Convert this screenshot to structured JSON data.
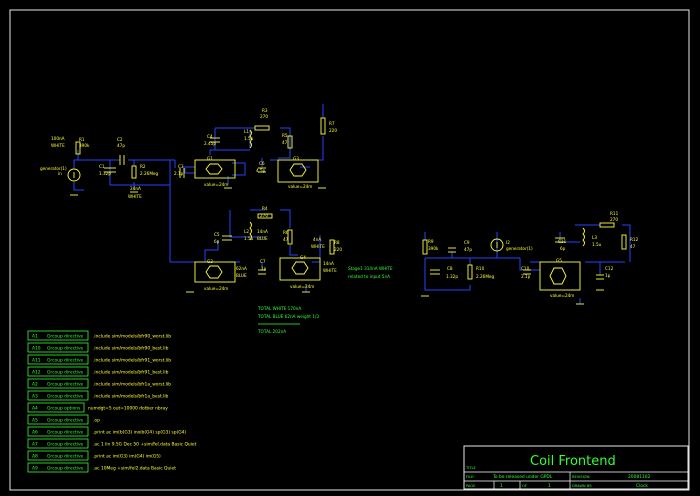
{
  "labels": {
    "src1_cur": "100nA",
    "src1_type": "WHITE",
    "r1": "R1",
    "r1_val": "390k",
    "c2": "C2",
    "c2_val": "47p",
    "c1": "C1",
    "c1_val": "1.32p",
    "r2": "R2",
    "r2_val": "2.26Meg",
    "gen1": "generator(1)",
    "gen1_pin": "in",
    "cur24": "24nA",
    "white24": "WHITE",
    "c3": "C3",
    "c3_val": "2.1p",
    "g1": "G1",
    "g1_val": "value=24m",
    "c4": "C4",
    "c4_val": "2.45p",
    "l1": "L1",
    "l1_val": "1.5u",
    "r3": "R3",
    "r3_val": "270",
    "r5": "R5",
    "r5_val": "47",
    "c6": "C6",
    "c6_val": "4.5p",
    "g3": "G3",
    "g3_val": "value=24m",
    "r7": "R7",
    "r7_val": "220",
    "c5": "C5",
    "c5_val": "6p",
    "l2": "L2",
    "l2_val": "1.5u",
    "r4": "R4",
    "r4_val": "270",
    "r6": "R6",
    "r6_val": "47",
    "cur14": "14nA",
    "blue14": "BLUE",
    "g2": "G2",
    "g2_cur": "62nA",
    "g2_type": "BLUE",
    "g2_val": "value=24m",
    "c7": "C7",
    "c7_val": "1p",
    "g4": "G4",
    "g4_cur": "14nA",
    "g4_type": "WHITE",
    "g4_val": "value=24m",
    "cur4": "4nA",
    "white4": "WHITE",
    "r8": "R8",
    "r8_val": "220",
    "stage1_a": "Stage1 314nA WHITE",
    "stage1_b": "related to input 5nA",
    "total_white": "TOTAL WHITE 170nA",
    "total_blue": "TOTAL BLUE 62nA weight 1/3",
    "total_total": "TOTAL 202nA",
    "r9": "R9",
    "r9_val": "390k",
    "c9": "C9",
    "c9_val": "47p",
    "c8": "C8",
    "c8_val": "1.32p",
    "r10": "R10",
    "r10_val": "2.26Meg",
    "i2": "I2",
    "i2_val": "generator(1)",
    "c10": "C10",
    "c10_val": "2.1p",
    "g5": "G5",
    "g5_val": "value=24m",
    "c11": "C11",
    "c11_val": "6p",
    "l3": "L3",
    "l3_val": "1.5u",
    "r11": "R11",
    "r11_val": "270",
    "r12": "R12",
    "r12_val": "47",
    "c12": "C12",
    "c12_val": "1p"
  },
  "directives": [
    {
      "name": "A1",
      "label": "Grcoup directive",
      "text": ".include sim/models/bfr90_worst.lib"
    },
    {
      "name": "A10",
      "label": "Grcoup directive",
      "text": ".include sim/models/bfr90_best.lib"
    },
    {
      "name": "A11",
      "label": "Grcoup directive",
      "text": ".include sim/models/bfr91_worst.lib"
    },
    {
      "name": "A12",
      "label": "Grcoup directive",
      "text": ".include sim/models/bfr91_best.lib"
    },
    {
      "name": "A2",
      "label": "Grcoup directive",
      "text": ".include sim/models/bfr1a_worst.lib"
    },
    {
      "name": "A3",
      "label": "Grcoup directive",
      "text": ".include sim/models/bfr1a_best.lib"
    },
    {
      "name": "A4",
      "label": "Grcoup options",
      "text": "numdgt=5 out=10000 dotber nbray"
    },
    {
      "name": "A5",
      "label": "Grcoup directive",
      "text": ".op"
    },
    {
      "name": "A6",
      "label": "Grcoup directive",
      "text": ".print ac im(b(G3) inoib(G4) sp(G3) sp(G4)"
    },
    {
      "name": "A7",
      "label": "Grcoup directive",
      "text": ".ac 1 lin 9.5G Dec 50 +sim/fel.data Basic Quiet"
    },
    {
      "name": "A8",
      "label": "Grcoup directive",
      "text": ".print ac im(G3) im(G4) im(G5)"
    },
    {
      "name": "A9",
      "label": "Grcoup directive",
      "text": ".ac 10Meg +sim/fel2.data Basic Quiet"
    }
  ],
  "titleblock": {
    "title": "Coil Frontend",
    "title_lbl": "TITLE",
    "file_lbl": "FILE:",
    "file_val": "To be released under GPDL",
    "rev_lbl": "REVISION:",
    "rev_val": "20081102",
    "page_lbl": "PAGE",
    "page_val": "1",
    "of_lbl": "OF",
    "of_val": "1",
    "drawn_lbl": "DRAWN BY:",
    "drawn_val": "Clock"
  },
  "colors": {
    "background": "#000000",
    "wire": "#2244ff",
    "component": "#ffff33",
    "frame": "#33ff33"
  }
}
